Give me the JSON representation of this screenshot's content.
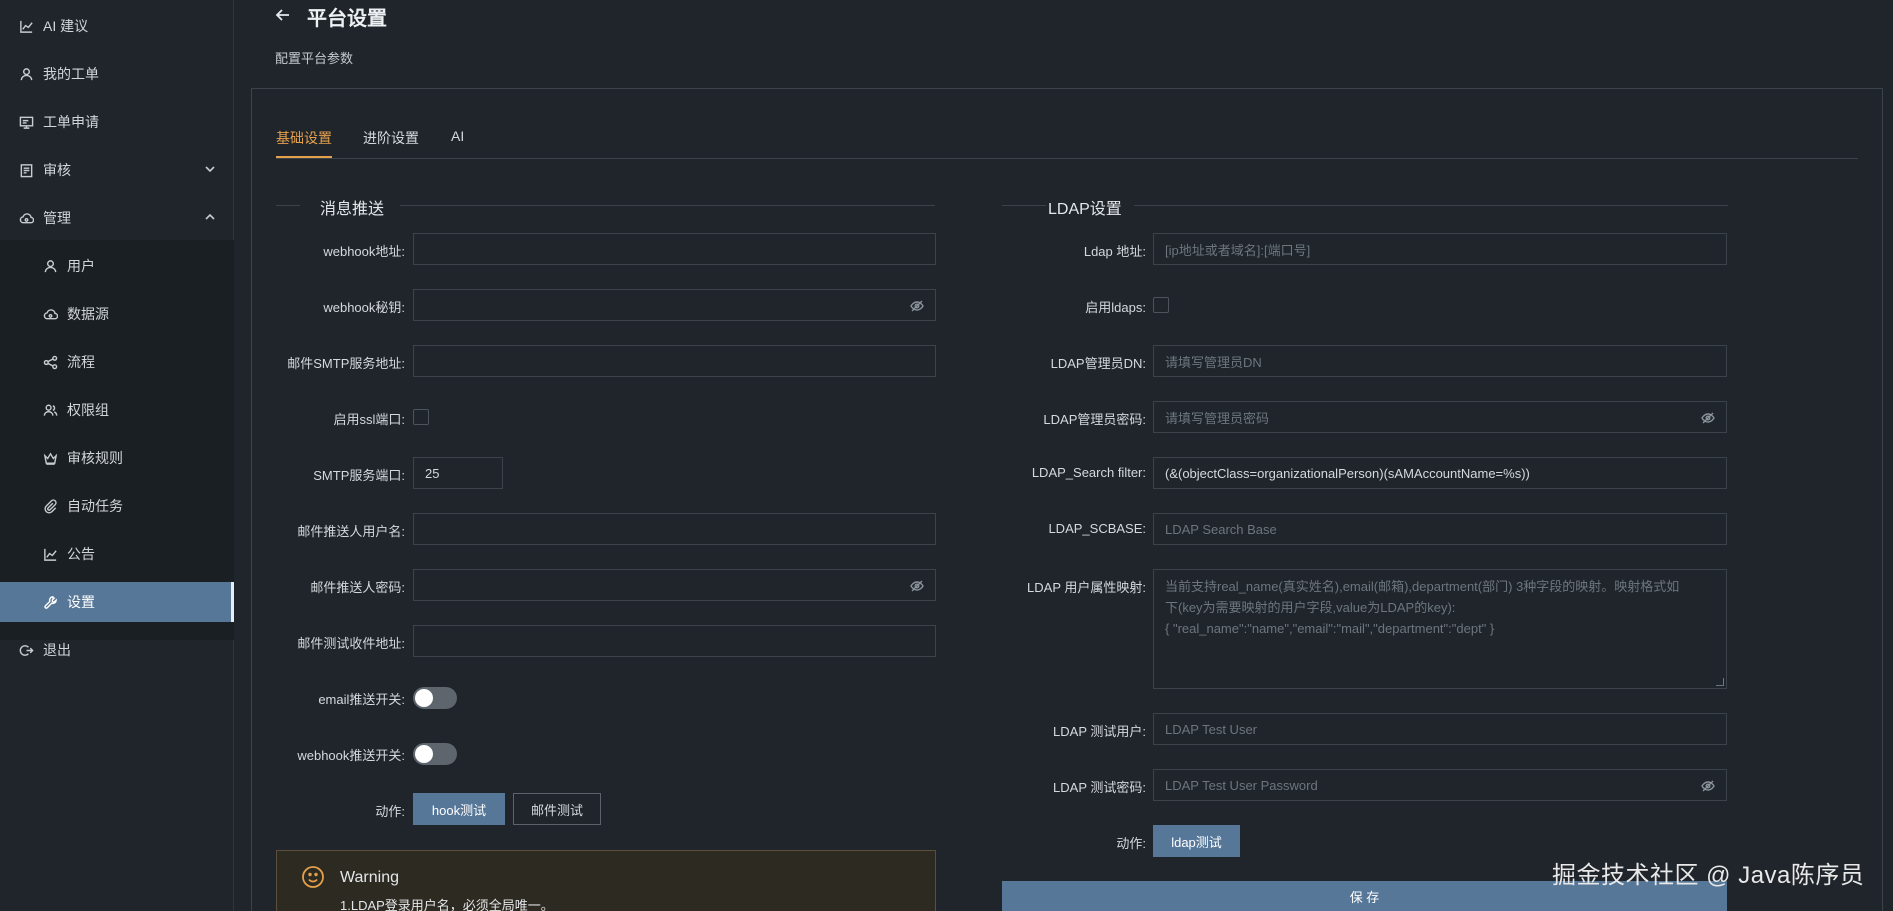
{
  "sidebar": {
    "items": [
      {
        "label": "AI 建议",
        "icon": "chart-icon"
      },
      {
        "label": "我的工单",
        "icon": "user-icon"
      },
      {
        "label": "工单申请",
        "icon": "monitor-icon"
      },
      {
        "label": "审核",
        "icon": "clipboard-icon",
        "chevron": "down"
      },
      {
        "label": "管理",
        "icon": "cloud-icon",
        "chevron": "up"
      }
    ],
    "sub_items": [
      {
        "label": "用户",
        "icon": "user-icon"
      },
      {
        "label": "数据源",
        "icon": "cloud-icon"
      },
      {
        "label": "流程",
        "icon": "share-icon"
      },
      {
        "label": "权限组",
        "icon": "users-icon"
      },
      {
        "label": "审核规则",
        "icon": "crown-icon"
      },
      {
        "label": "自动任务",
        "icon": "paperclip-icon"
      },
      {
        "label": "公告",
        "icon": "chart-icon"
      },
      {
        "label": "设置",
        "icon": "wrench-icon",
        "active": true
      }
    ],
    "logout": {
      "label": "退出",
      "icon": "logout-icon"
    }
  },
  "header": {
    "title": "平台设置",
    "subtitle": "配置平台参数"
  },
  "tabs": [
    "基础设置",
    "进阶设置",
    "AI"
  ],
  "message_push": {
    "section_title": "消息推送",
    "fields": {
      "webhook_url": {
        "label": "webhook地址:",
        "value": ""
      },
      "webhook_secret": {
        "label": "webhook秘钥:",
        "value": ""
      },
      "smtp_host": {
        "label": "邮件SMTP服务地址:",
        "value": ""
      },
      "ssl_port": {
        "label": "启用ssl端口:"
      },
      "smtp_port": {
        "label": "SMTP服务端口:",
        "value": "25"
      },
      "smtp_user": {
        "label": "邮件推送人用户名:",
        "value": ""
      },
      "smtp_password": {
        "label": "邮件推送人密码:",
        "value": ""
      },
      "test_receiver": {
        "label": "邮件测试收件地址:",
        "value": ""
      },
      "email_switch": {
        "label": "email推送开关:"
      },
      "webhook_switch": {
        "label": "webhook推送开关:"
      }
    },
    "action_label": "动作:",
    "hook_test": "hook测试",
    "mail_test": "邮件测试"
  },
  "ldap": {
    "section_title": "LDAP设置",
    "fields": {
      "address": {
        "label": "Ldap 地址:",
        "placeholder": "[ip地址或者域名]:[端口号]"
      },
      "ldaps": {
        "label": "启用ldaps:"
      },
      "admin_dn": {
        "label": "LDAP管理员DN:",
        "placeholder": "请填写管理员DN"
      },
      "admin_password": {
        "label": "LDAP管理员密码:",
        "placeholder": "请填写管理员密码"
      },
      "search_filter": {
        "label": "LDAP_Search filter:",
        "value": "(&(objectClass=organizationalPerson)(sAMAccountName=%s))"
      },
      "scbase": {
        "label": "LDAP_SCBASE:",
        "placeholder": "LDAP Search Base"
      },
      "attr_map": {
        "label": "LDAP 用户属性映射:",
        "placeholder_line1": "当前支持real_name(真实姓名),email(邮箱),department(部门) 3种字段的映射。映射格式如",
        "placeholder_line2": "下(key为需要映射的用户字段,value为LDAP的key):",
        "placeholder_line3": "{ \"real_name\":\"name\",\"email\":\"mail\",\"department\":\"dept\" }"
      },
      "test_user": {
        "label": "LDAP 测试用户:",
        "placeholder": "LDAP Test User"
      },
      "test_password": {
        "label": "LDAP 测试密码:",
        "placeholder": "LDAP Test User Password"
      }
    },
    "action_label": "动作:",
    "ldap_test": "ldap测试"
  },
  "save_label": "保 存",
  "warning": {
    "title": "Warning",
    "body": "1.LDAP登录用户名，必须全局唯一。"
  },
  "watermark": "掘金技术社区 @ Java陈序员",
  "colors": {
    "accent": "#e5a04c",
    "primary": "#577799",
    "background": "#1f252b"
  }
}
